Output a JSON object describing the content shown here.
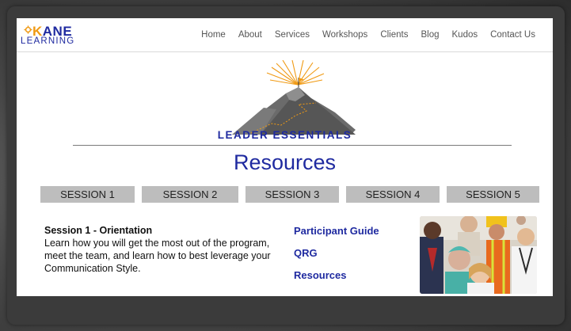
{
  "logo": {
    "line1_first": "K",
    "line1_rest": "ANE",
    "line2": "LEARNING"
  },
  "nav": [
    "Home",
    "About",
    "Services",
    "Workshops",
    "Clients",
    "Blog",
    "Kudos",
    "Contact Us"
  ],
  "brand": "LEADER ESSENTIALS",
  "page_title": "Resources",
  "tabs": [
    "SESSION 1",
    "SESSION 2",
    "SESSION 3",
    "SESSION 4",
    "SESSION 5"
  ],
  "session": {
    "title": "Session 1 - Orientation",
    "description": "Learn how you will get the most out of the program, meet the team, and learn how to best leverage your Communication Style."
  },
  "links": [
    "Participant Guide",
    "QRG",
    "Resources"
  ],
  "colors": {
    "brand_blue": "#1f2aa0",
    "accent_orange": "#f09a14",
    "tab_gray": "#bdbdbd"
  },
  "icons": [
    "gear-icon",
    "mountain-logo",
    "people-photo"
  ]
}
